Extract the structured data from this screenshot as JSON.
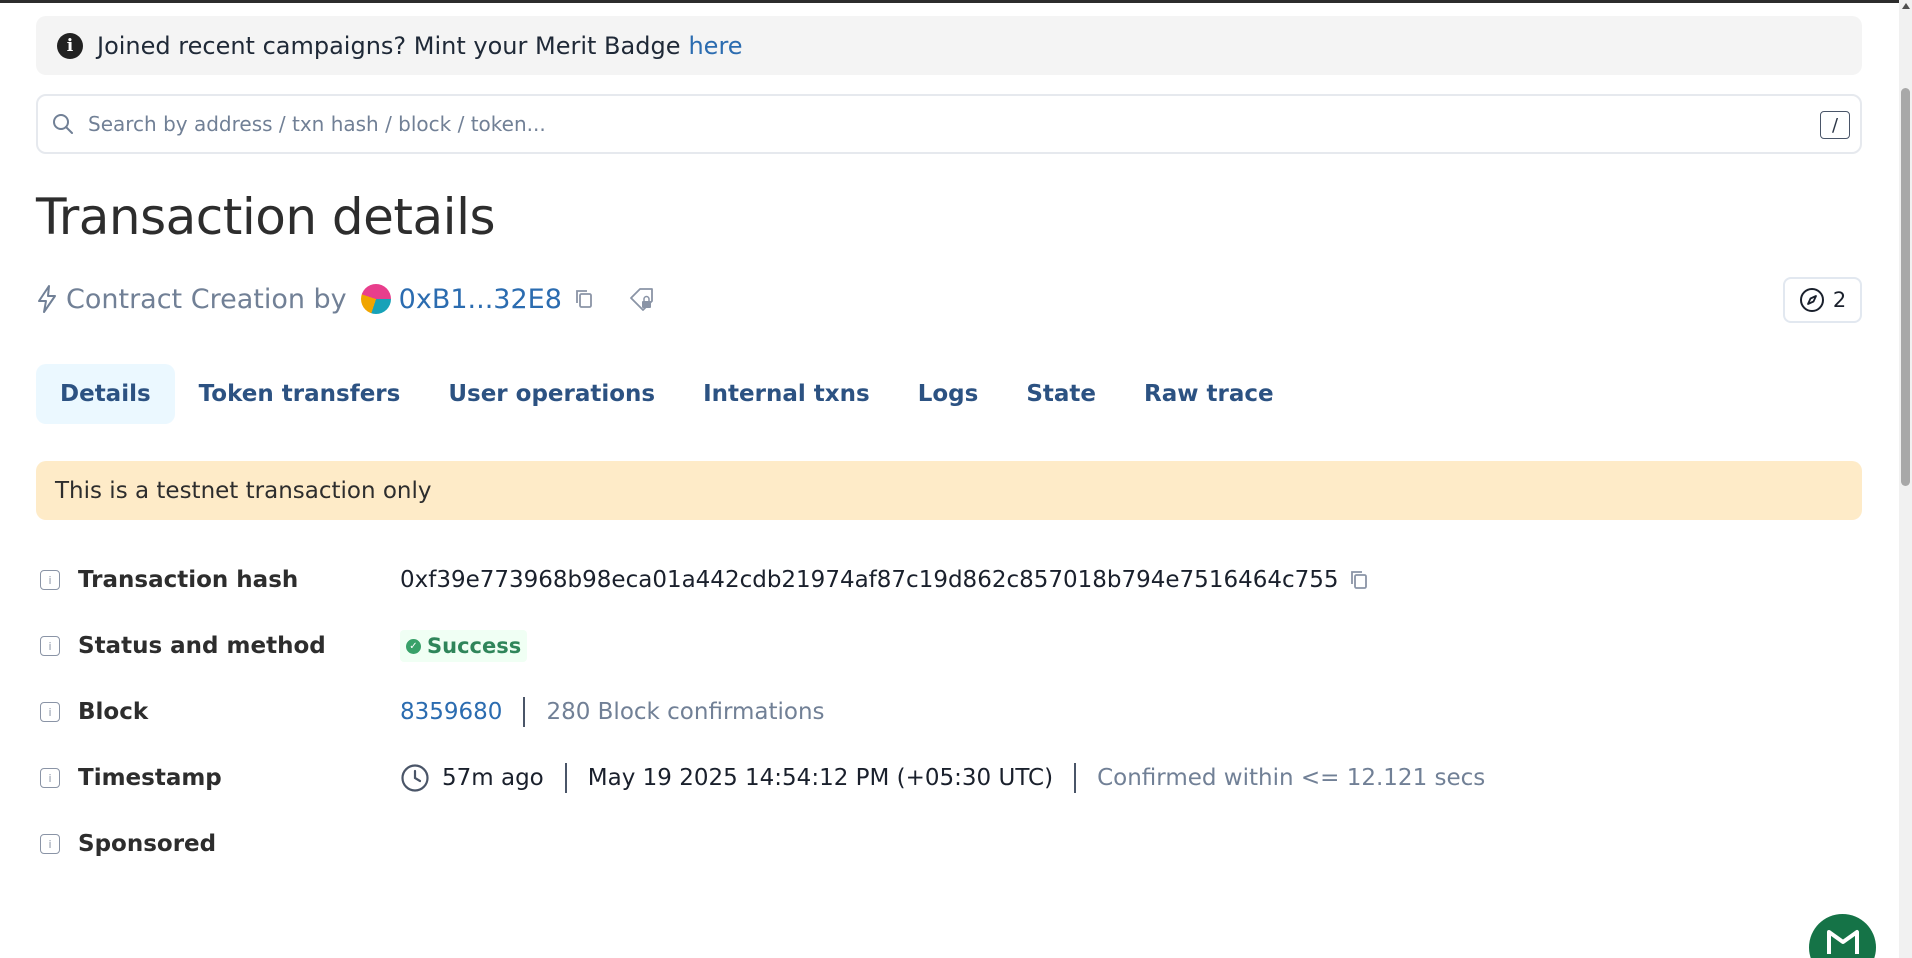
{
  "banner": {
    "text": "Joined recent campaigns? Mint your Merit Badge",
    "link_label": "here"
  },
  "search": {
    "placeholder": "Search by address / txn hash / block / token...",
    "shortcut": "/"
  },
  "page": {
    "title": "Transaction details"
  },
  "subtitle": {
    "prefix": "Contract Creation by",
    "address": "0xB1...32E8"
  },
  "interpretation": {
    "count": "2"
  },
  "tabs": [
    {
      "label": "Details",
      "active": true
    },
    {
      "label": "Token transfers"
    },
    {
      "label": "User operations"
    },
    {
      "label": "Internal txns"
    },
    {
      "label": "Logs"
    },
    {
      "label": "State"
    },
    {
      "label": "Raw trace"
    }
  ],
  "notice": {
    "text": "This is a testnet transaction only",
    "color": "#feebc8"
  },
  "details": {
    "hash": {
      "label": "Transaction hash",
      "value": "0xf39e773968b98eca01a442cdb21974af87c19d862c857018b794e7516464c755"
    },
    "status": {
      "label": "Status and method",
      "value": "Success",
      "color": "#2f855a"
    },
    "block": {
      "label": "Block",
      "number": "8359680",
      "confirmations": "280 Block confirmations"
    },
    "timestamp": {
      "label": "Timestamp",
      "relative": "57m ago",
      "absolute": "May 19 2025 14:54:12 PM (+05:30 UTC)",
      "confirmed": "Confirmed within <= 12.121 secs"
    },
    "sponsored": {
      "label": "Sponsored"
    }
  },
  "colors": {
    "link": "#2b6cb0",
    "tab_active_bg": "#ebf8ff",
    "fab": "#157347"
  }
}
